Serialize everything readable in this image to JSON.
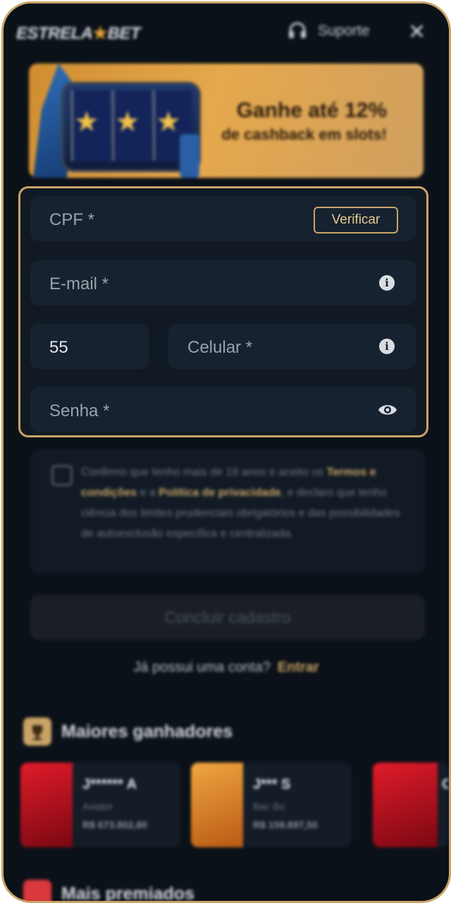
{
  "header": {
    "logo_left": "ESTRELA",
    "logo_star": "★",
    "logo_right": "BET",
    "support_label": "Suporte",
    "close_glyph": "✕"
  },
  "banner": {
    "line1": "Ganhe até 12%",
    "line2": "de cashback em slots!"
  },
  "form": {
    "cpf_placeholder": "CPF *",
    "verify_label": "Verificar",
    "email_placeholder": "E-mail *",
    "country_code": "55",
    "phone_placeholder": "Celular *",
    "password_placeholder": "Senha *"
  },
  "terms": {
    "text_1": "Confirmo que tenho mais de 18 anos e aceito os ",
    "terms_link": "Termos e condições",
    "text_2": " e a ",
    "privacy_link": "Política de privacidade",
    "text_3": ", e declaro que tenho ciência dos limites prudenciais obrigatórios e das possibilidades de autoexclusão específica e centralizada."
  },
  "submit_label": "Concluir cadastro",
  "login": {
    "question": "Já possui uma conta?",
    "link": "Entrar"
  },
  "winners": {
    "title": "Maiores ganhadores",
    "cards": [
      {
        "name": "J****** A",
        "game": "Aviator",
        "amount": "R$ 673.802,80"
      },
      {
        "name": "J*** S",
        "game": "Bac Bo",
        "amount": "R$ 159.897,50"
      },
      {
        "name": "C",
        "game": "",
        "amount": ""
      }
    ]
  },
  "section2_title": "Mais premiados",
  "colors": {
    "accent": "#c9a467",
    "background": "#0b1118",
    "field": "#172230"
  },
  "icons": [
    "headset-icon",
    "close-icon",
    "info-icon",
    "eye-icon",
    "trophy-icon"
  ]
}
